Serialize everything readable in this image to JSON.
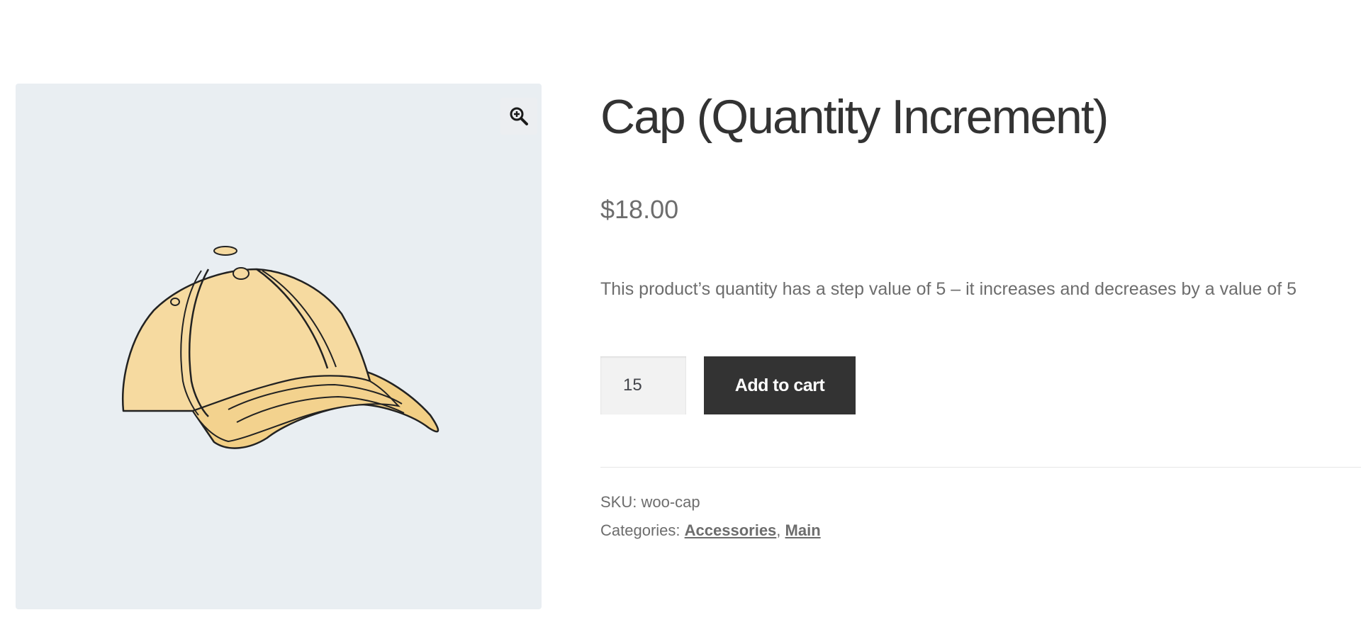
{
  "product": {
    "title": "Cap (Quantity Increment)",
    "price": "$18.00",
    "description": "This product’s quantity has a step value of 5 – it increases and decreases by a value of 5",
    "image_icon": "cap-image"
  },
  "gallery": {
    "zoom_icon": "zoom-in-icon"
  },
  "cart": {
    "quantity": "15",
    "add_to_cart_label": "Add to cart"
  },
  "meta": {
    "sku_label": "SKU:",
    "sku_value": "woo-cap",
    "categories_label": "Categories:",
    "categories": [
      "Accessories",
      "Main"
    ],
    "separator": ","
  },
  "colors": {
    "button_bg": "#333333",
    "gallery_bg": "#e9eef2",
    "cap_fill": "#f5d89a",
    "text": "#6d6d6d",
    "title": "#333333"
  }
}
